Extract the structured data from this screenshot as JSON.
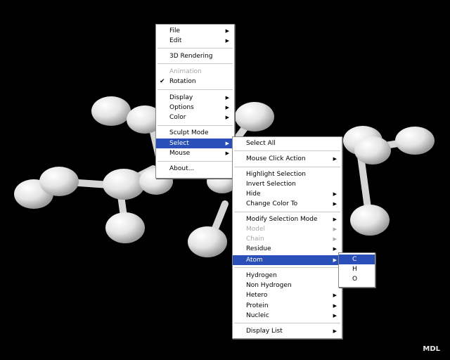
{
  "context_menu": {
    "items": [
      {
        "label": "File",
        "submenu": true
      },
      {
        "label": "Edit",
        "submenu": true
      },
      {
        "label": "3D Rendering"
      },
      {
        "label": "Animation",
        "disabled": true
      },
      {
        "label": "Rotation",
        "checked": true
      },
      {
        "label": "Display",
        "submenu": true
      },
      {
        "label": "Options",
        "submenu": true
      },
      {
        "label": "Color",
        "submenu": true
      },
      {
        "label": "Sculpt Mode"
      },
      {
        "label": "Select",
        "submenu": true,
        "highlighted": true
      },
      {
        "label": "Mouse",
        "submenu": true
      },
      {
        "label": "About..."
      }
    ]
  },
  "select_submenu": {
    "items": [
      {
        "label": "Select All"
      },
      {
        "label": "Mouse Click Action",
        "submenu": true
      },
      {
        "label": "Highlight Selection"
      },
      {
        "label": "Invert Selection"
      },
      {
        "label": "Hide",
        "submenu": true
      },
      {
        "label": "Change Color To",
        "submenu": true
      },
      {
        "label": "Modify Selection Mode",
        "submenu": true
      },
      {
        "label": "Model",
        "submenu": true,
        "disabled": true
      },
      {
        "label": "Chain",
        "submenu": true,
        "disabled": true
      },
      {
        "label": "Residue",
        "submenu": true
      },
      {
        "label": "Atom",
        "submenu": true,
        "highlighted": true
      },
      {
        "label": "Hydrogen"
      },
      {
        "label": "Non Hydrogen"
      },
      {
        "label": "Hetero",
        "submenu": true
      },
      {
        "label": "Protein",
        "submenu": true
      },
      {
        "label": "Nucleic",
        "submenu": true
      },
      {
        "label": "Display List",
        "submenu": true
      }
    ]
  },
  "atom_submenu": {
    "items": [
      {
        "label": "C",
        "highlighted": true
      },
      {
        "label": "H"
      },
      {
        "label": "O"
      }
    ]
  },
  "watermark": "MDL",
  "colors": {
    "background": "#000000",
    "menu_highlight": "#2a4fb8",
    "atom": "#e6e6e6"
  }
}
